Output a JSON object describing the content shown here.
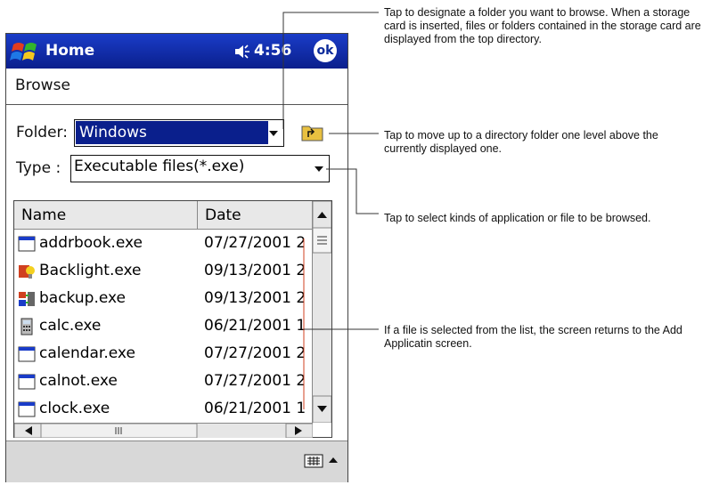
{
  "titlebar": {
    "title": "Home",
    "time": "4:56",
    "ok_label": "ok"
  },
  "menu": {
    "browse_label": "Browse"
  },
  "folder": {
    "label": "Folder:",
    "value": "Windows"
  },
  "type": {
    "label": "Type :",
    "value": "Executable files(*.exe)"
  },
  "list": {
    "columns": [
      "Name",
      "Date"
    ],
    "rows": [
      {
        "name": "addrbook.exe",
        "date": "07/27/2001 2"
      },
      {
        "name": "Backlight.exe",
        "date": "09/13/2001 2"
      },
      {
        "name": "backup.exe",
        "date": "09/13/2001 2"
      },
      {
        "name": "calc.exe",
        "date": "06/21/2001 1"
      },
      {
        "name": "calendar.exe",
        "date": "07/27/2001 2"
      },
      {
        "name": "calnot.exe",
        "date": "07/27/2001 2"
      },
      {
        "name": "clock.exe",
        "date": "06/21/2001 1"
      }
    ]
  },
  "callouts": {
    "folder": "Tap to designate a folder you want to browse. When a storage card is inserted, files or folders contained in the storage card are displayed from the top directory.",
    "up": "Tap to move up to a directory folder one level above the currently displayed one.",
    "type": "Tap to select kinds of application or file to be browsed.",
    "file": "If a file is selected from the list, the screen returns to the Add Applicatin screen."
  },
  "icons": {
    "start": "windows-flag-icon",
    "speaker": "speaker-icon",
    "up": "folder-up-icon",
    "keyboard": "keyboard-icon"
  }
}
